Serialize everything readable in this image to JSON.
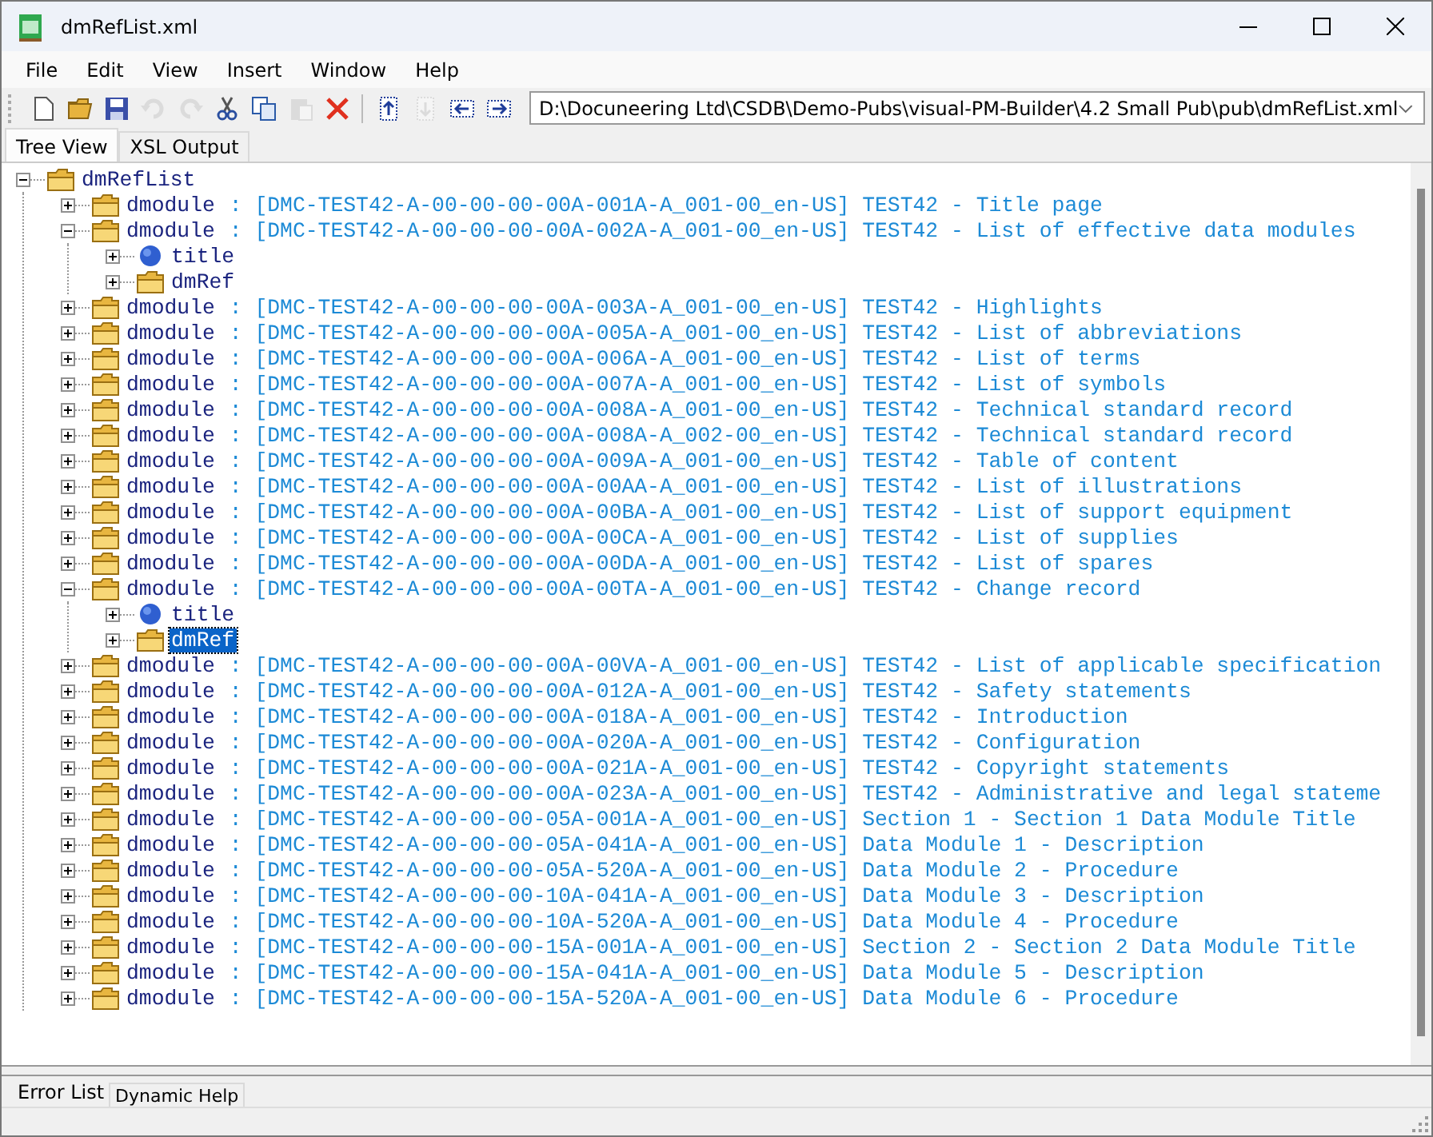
{
  "window": {
    "title": "dmRefList.xml"
  },
  "menu": [
    "File",
    "Edit",
    "View",
    "Insert",
    "Window",
    "Help"
  ],
  "toolbar": [
    {
      "kind": "new",
      "disabled": false
    },
    {
      "kind": "open",
      "disabled": false
    },
    {
      "kind": "save",
      "disabled": false
    },
    {
      "kind": "undo",
      "disabled": true
    },
    {
      "kind": "redo",
      "disabled": true
    },
    {
      "kind": "cut",
      "disabled": false
    },
    {
      "kind": "copy",
      "disabled": false
    },
    {
      "kind": "paste",
      "disabled": true
    },
    {
      "kind": "delete",
      "disabled": false
    },
    {
      "kind": "separator"
    },
    {
      "kind": "up",
      "disabled": false
    },
    {
      "kind": "down",
      "disabled": true
    },
    {
      "kind": "outdent",
      "disabled": false
    },
    {
      "kind": "indent",
      "disabled": false
    }
  ],
  "path_box": {
    "value": "D:\\Docuneering Ltd\\CSDB\\Demo-Pubs\\visual-PM-Builder\\4.2 Small Pub\\pub\\dmRefList.xml"
  },
  "tabs": [
    {
      "label": "Tree View",
      "selected": true
    },
    {
      "label": "XSL Output",
      "selected": false
    }
  ],
  "tree": {
    "name": "dmRefList",
    "kind": "folder",
    "expanded": true,
    "selected": false,
    "children": [
      {
        "name": "dmodule",
        "description": ": [DMC-TEST42-A-00-00-00-00A-001A-A_001-00_en-US] TEST42 - Title page",
        "kind": "folder",
        "expanded": false,
        "selected": false
      },
      {
        "name": "dmodule",
        "description": ": [DMC-TEST42-A-00-00-00-00A-002A-A_001-00_en-US] TEST42 - List of effective data modules",
        "kind": "folder",
        "expanded": true,
        "selected": false,
        "children": [
          {
            "name": "title",
            "kind": "circle",
            "expanded": false,
            "selected": false
          },
          {
            "name": "dmRef",
            "kind": "folder",
            "expanded": false,
            "selected": false
          }
        ]
      },
      {
        "name": "dmodule",
        "description": ": [DMC-TEST42-A-00-00-00-00A-003A-A_001-00_en-US] TEST42 - Highlights",
        "kind": "folder",
        "expanded": false,
        "selected": false
      },
      {
        "name": "dmodule",
        "description": ": [DMC-TEST42-A-00-00-00-00A-005A-A_001-00_en-US] TEST42 - List of abbreviations",
        "kind": "folder",
        "expanded": false,
        "selected": false
      },
      {
        "name": "dmodule",
        "description": ": [DMC-TEST42-A-00-00-00-00A-006A-A_001-00_en-US] TEST42 - List of terms",
        "kind": "folder",
        "expanded": false,
        "selected": false
      },
      {
        "name": "dmodule",
        "description": ": [DMC-TEST42-A-00-00-00-00A-007A-A_001-00_en-US] TEST42 - List of symbols",
        "kind": "folder",
        "expanded": false,
        "selected": false
      },
      {
        "name": "dmodule",
        "description": ": [DMC-TEST42-A-00-00-00-00A-008A-A_001-00_en-US] TEST42 - Technical standard record",
        "kind": "folder",
        "expanded": false,
        "selected": false
      },
      {
        "name": "dmodule",
        "description": ": [DMC-TEST42-A-00-00-00-00A-008A-A_002-00_en-US] TEST42 - Technical standard record",
        "kind": "folder",
        "expanded": false,
        "selected": false
      },
      {
        "name": "dmodule",
        "description": ": [DMC-TEST42-A-00-00-00-00A-009A-A_001-00_en-US] TEST42 - Table of content",
        "kind": "folder",
        "expanded": false,
        "selected": false
      },
      {
        "name": "dmodule",
        "description": ": [DMC-TEST42-A-00-00-00-00A-00AA-A_001-00_en-US] TEST42 - List of illustrations",
        "kind": "folder",
        "expanded": false,
        "selected": false
      },
      {
        "name": "dmodule",
        "description": ": [DMC-TEST42-A-00-00-00-00A-00BA-A_001-00_en-US] TEST42 - List of support equipment",
        "kind": "folder",
        "expanded": false,
        "selected": false
      },
      {
        "name": "dmodule",
        "description": ": [DMC-TEST42-A-00-00-00-00A-00CA-A_001-00_en-US] TEST42 - List of supplies",
        "kind": "folder",
        "expanded": false,
        "selected": false
      },
      {
        "name": "dmodule",
        "description": ": [DMC-TEST42-A-00-00-00-00A-00DA-A_001-00_en-US] TEST42 - List of spares",
        "kind": "folder",
        "expanded": false,
        "selected": false
      },
      {
        "name": "dmodule",
        "description": ": [DMC-TEST42-A-00-00-00-00A-00TA-A_001-00_en-US] TEST42 - Change record",
        "kind": "folder",
        "expanded": true,
        "selected": false,
        "children": [
          {
            "name": "title",
            "kind": "circle",
            "expanded": false,
            "selected": false
          },
          {
            "name": "dmRef",
            "kind": "folder",
            "expanded": false,
            "selected": true
          }
        ]
      },
      {
        "name": "dmodule",
        "description": ": [DMC-TEST42-A-00-00-00-00A-00VA-A_001-00_en-US] TEST42 - List of applicable specification",
        "kind": "folder",
        "expanded": false,
        "selected": false
      },
      {
        "name": "dmodule",
        "description": ": [DMC-TEST42-A-00-00-00-00A-012A-A_001-00_en-US] TEST42 - Safety statements",
        "kind": "folder",
        "expanded": false,
        "selected": false
      },
      {
        "name": "dmodule",
        "description": ": [DMC-TEST42-A-00-00-00-00A-018A-A_001-00_en-US] TEST42 - Introduction",
        "kind": "folder",
        "expanded": false,
        "selected": false
      },
      {
        "name": "dmodule",
        "description": ": [DMC-TEST42-A-00-00-00-00A-020A-A_001-00_en-US] TEST42 - Configuration",
        "kind": "folder",
        "expanded": false,
        "selected": false
      },
      {
        "name": "dmodule",
        "description": ": [DMC-TEST42-A-00-00-00-00A-021A-A_001-00_en-US] TEST42 - Copyright statements",
        "kind": "folder",
        "expanded": false,
        "selected": false
      },
      {
        "name": "dmodule",
        "description": ": [DMC-TEST42-A-00-00-00-00A-023A-A_001-00_en-US] TEST42 - Administrative and legal stateme",
        "kind": "folder",
        "expanded": false,
        "selected": false
      },
      {
        "name": "dmodule",
        "description": ": [DMC-TEST42-A-00-00-00-05A-001A-A_001-00_en-US] Section 1 - Section 1 Data Module Title",
        "kind": "folder",
        "expanded": false,
        "selected": false
      },
      {
        "name": "dmodule",
        "description": ": [DMC-TEST42-A-00-00-00-05A-041A-A_001-00_en-US] Data Module 1 - Description",
        "kind": "folder",
        "expanded": false,
        "selected": false
      },
      {
        "name": "dmodule",
        "description": ": [DMC-TEST42-A-00-00-00-05A-520A-A_001-00_en-US] Data Module 2 - Procedure",
        "kind": "folder",
        "expanded": false,
        "selected": false
      },
      {
        "name": "dmodule",
        "description": ": [DMC-TEST42-A-00-00-00-10A-041A-A_001-00_en-US] Data Module 3 - Description",
        "kind": "folder",
        "expanded": false,
        "selected": false
      },
      {
        "name": "dmodule",
        "description": ": [DMC-TEST42-A-00-00-00-10A-520A-A_001-00_en-US] Data Module 4 - Procedure",
        "kind": "folder",
        "expanded": false,
        "selected": false
      },
      {
        "name": "dmodule",
        "description": ": [DMC-TEST42-A-00-00-00-15A-001A-A_001-00_en-US] Section 2 - Section 2 Data Module Title",
        "kind": "folder",
        "expanded": false,
        "selected": false
      },
      {
        "name": "dmodule",
        "description": ": [DMC-TEST42-A-00-00-00-15A-041A-A_001-00_en-US] Data Module 5 - Description",
        "kind": "folder",
        "expanded": false,
        "selected": false
      },
      {
        "name": "dmodule",
        "description": ": [DMC-TEST42-A-00-00-00-15A-520A-A_001-00_en-US] Data Module 6 - Procedure",
        "kind": "folder",
        "expanded": false,
        "selected": false
      }
    ]
  },
  "bottom_tabs": [
    {
      "label": "Error List",
      "selected": true
    },
    {
      "label": "Dynamic Help",
      "selected": false
    }
  ]
}
